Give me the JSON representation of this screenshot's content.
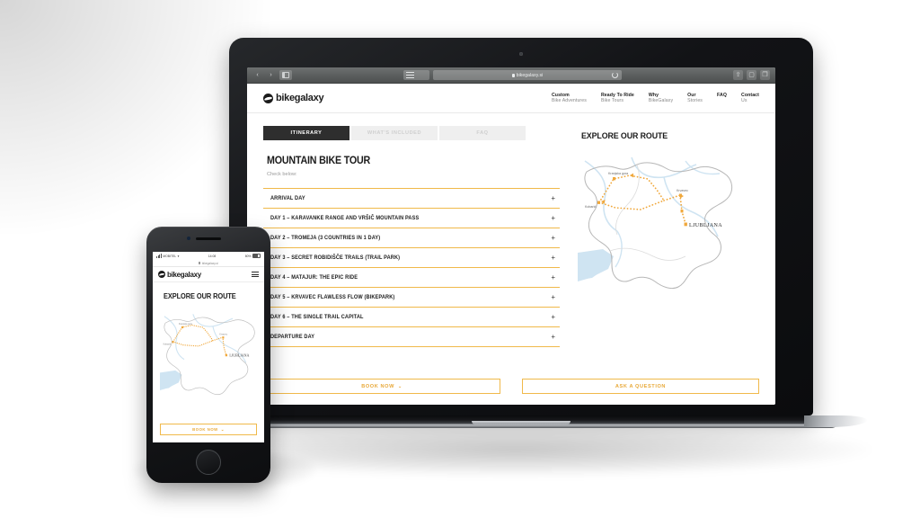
{
  "browser": {
    "back_label": "‹",
    "forward_label": "›",
    "url": "bikegalaxy.si",
    "lock_icon": "lock-icon",
    "reload_icon": "reload-icon",
    "share_icon": "share-icon",
    "tabs_icon": "tabs-icon",
    "sidebar_icon": "sidebar-icon",
    "search_icon": "search-icon"
  },
  "site": {
    "logo_text": "bikegalaxy",
    "nav": [
      {
        "line1": "Custom",
        "line2": "Bike Adventures"
      },
      {
        "line1": "Ready To Ride",
        "line2": "Bike Tours"
      },
      {
        "line1": "Why",
        "line2": "BikeGalaxy"
      },
      {
        "line1": "Our",
        "line2": "Stories"
      },
      {
        "line1": "FAQ",
        "line2": ""
      },
      {
        "line1": "Contact",
        "line2": "Us"
      }
    ],
    "tabs": [
      {
        "label": "ITINERARY",
        "active": true
      },
      {
        "label": "WHAT'S INCLUDED",
        "active": false
      },
      {
        "label": "FAQ",
        "active": false
      }
    ],
    "tour_title": "MOUNTAIN BIKE TOUR",
    "tour_subtitle": "Check below:",
    "itinerary": [
      {
        "label": "ARRIVAL DAY",
        "expander": "+"
      },
      {
        "label": "DAY 1 – KARAVANKE RANGE AND VRŠIČ MOUNTAIN PASS",
        "expander": "+"
      },
      {
        "label": "DAY 2 – TROMEJA (3 COUNTRIES IN 1 DAY)",
        "expander": "+"
      },
      {
        "label": "DAY 3 – SECRET ROBIDIŠČE TRAILS (TRAIL PARK)",
        "expander": "+"
      },
      {
        "label": "DAY 4 – MATAJUR: THE EPIC RIDE",
        "expander": "+"
      },
      {
        "label": "DAY 5 – KRVAVEC FLAWLESS FLOW (BIKEPARK)",
        "expander": "+"
      },
      {
        "label": "DAY 6 – THE SINGLE TRAIL CAPITAL",
        "expander": "+"
      },
      {
        "label": "DEPARTURE DAY",
        "expander": "+"
      }
    ],
    "route_title": "EXPLORE OUR ROUTE",
    "map": {
      "capital_label": "LJUBLJANA",
      "stop_labels": [
        "Kranjska gora",
        "Kobarid",
        "Krvavec"
      ],
      "route_color": "#f0a83c",
      "water_color": "#cfe4f2",
      "border_color": "#b7b7b7"
    },
    "cta_primary": "BOOK NOW",
    "cta_primary_chevron": "⌄",
    "cta_secondary": "ASK A QUESTION"
  },
  "phone": {
    "carrier": "MOBITEL",
    "time": "14:08",
    "battery": "80%",
    "url": "bikegalaxy.si",
    "logo_text": "bikegalaxy",
    "menu_icon": "hamburger-icon",
    "title": "EXPLORE OUR ROUTE",
    "cta": "BOOK NOW",
    "cta_chevron": "⌄"
  },
  "colors": {
    "accent": "#f0b94a",
    "accent_text": "#e8a93a",
    "dark": "#1b1b1b",
    "tab_inactive_bg": "#efefef"
  }
}
